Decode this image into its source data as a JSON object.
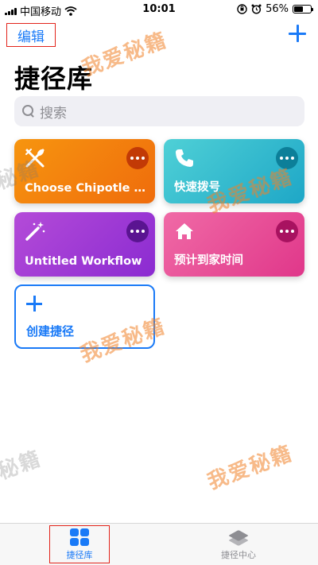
{
  "status_bar": {
    "carrier": "中国移动",
    "time": "10:01",
    "battery_percent": "56%",
    "battery_level": 0.56,
    "icons": [
      "signal-icon",
      "wifi-icon",
      "orientation-lock-icon",
      "alarm-icon",
      "battery-icon"
    ]
  },
  "header": {
    "edit_label": "编辑",
    "title": "捷径库"
  },
  "search": {
    "placeholder": "搜索"
  },
  "shortcuts": [
    {
      "label": "Choose Chipotle O…",
      "icon": "utensils-icon",
      "color": "#f2800e"
    },
    {
      "label": "快速拨号",
      "icon": "phone-icon",
      "color": "#2fbcd0"
    },
    {
      "label": "Untitled Workflow",
      "icon": "magic-wand-icon",
      "color": "#a03dd6"
    },
    {
      "label": "预计到家时间",
      "icon": "home-icon",
      "color": "#e84c96"
    }
  ],
  "create_label": "创建捷径",
  "watermarks": [
    "我爱秘籍",
    "我爱秘籍",
    "秘籍",
    "我爱秘籍",
    "秘籍",
    "我爱秘籍"
  ],
  "tabs": [
    {
      "label": "捷径库",
      "icon": "grid-icon",
      "active": true
    },
    {
      "label": "捷径中心",
      "icon": "layers-icon",
      "active": false
    }
  ],
  "colors": {
    "accent": "#1a7af7",
    "highlight_box": "#e2231a"
  }
}
